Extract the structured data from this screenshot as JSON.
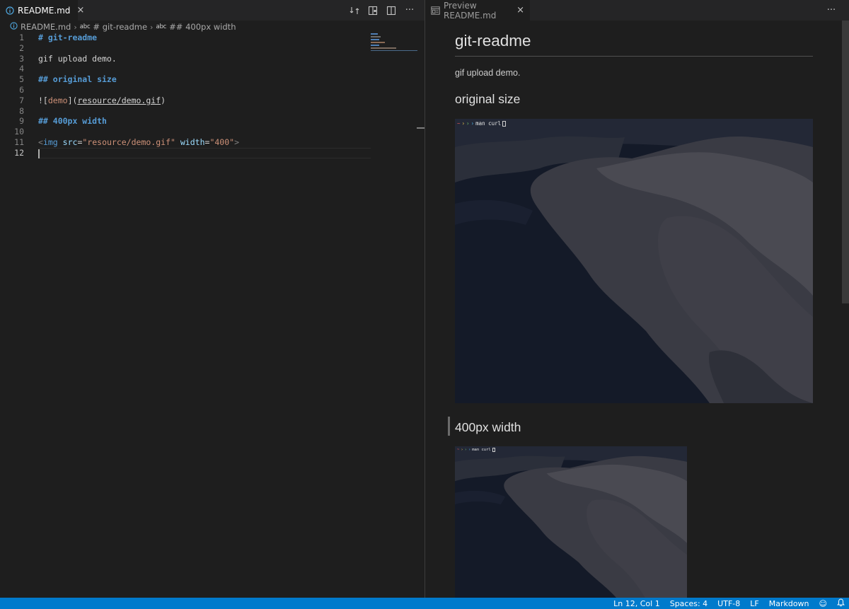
{
  "left_editor": {
    "tab": {
      "label": "README.md",
      "close": "×"
    },
    "actions": {
      "more": "···"
    },
    "breadcrumb": {
      "file": "README.md",
      "sym1_icon": "abc",
      "sym1": "# git-readme",
      "sym2_icon": "abc",
      "sym2": "## 400px width"
    },
    "line_numbers": [
      "1",
      "2",
      "3",
      "4",
      "5",
      "6",
      "7",
      "8",
      "9",
      "10",
      "11",
      "12"
    ],
    "lines": {
      "l1": "# git-readme",
      "l3": "gif upload demo.",
      "l5": "## original size",
      "l7_a": "![",
      "l7_b": "demo",
      "l7_c": "](",
      "l7_d": "resource/demo.gif",
      "l7_e": ")",
      "l9": "## 400px width",
      "l11_open": "<",
      "l11_tag": "img",
      "l11_attr1": "src",
      "l11_eq1": "=",
      "l11_val1": "\"resource/demo.gif\"",
      "l11_attr2": "width",
      "l11_eq2": "=",
      "l11_val2": "\"400\"",
      "l11_close": ">"
    }
  },
  "right_editor": {
    "tab": {
      "label": "Preview README.md",
      "close": "×"
    },
    "actions": {
      "more": "···"
    },
    "preview": {
      "h1": "git-readme",
      "paragraph": "gif upload demo.",
      "h2_original": "original size",
      "h2_width": "400px width",
      "terminal_command": "man curl",
      "prompt_glyph": "~",
      "prompt_arrows": [
        "›",
        "›",
        "›"
      ]
    }
  },
  "status_bar": {
    "position": "Ln 12, Col 1",
    "indent": "Spaces: 4",
    "encoding": "UTF-8",
    "eol": "LF",
    "language": "Markdown",
    "feedback_icon": "☺",
    "bell_icon": "bell-icon"
  },
  "colors": {
    "accent": "#007acc",
    "heading": "#569cd6",
    "string": "#ce9178",
    "attribute": "#9cdcfe"
  }
}
